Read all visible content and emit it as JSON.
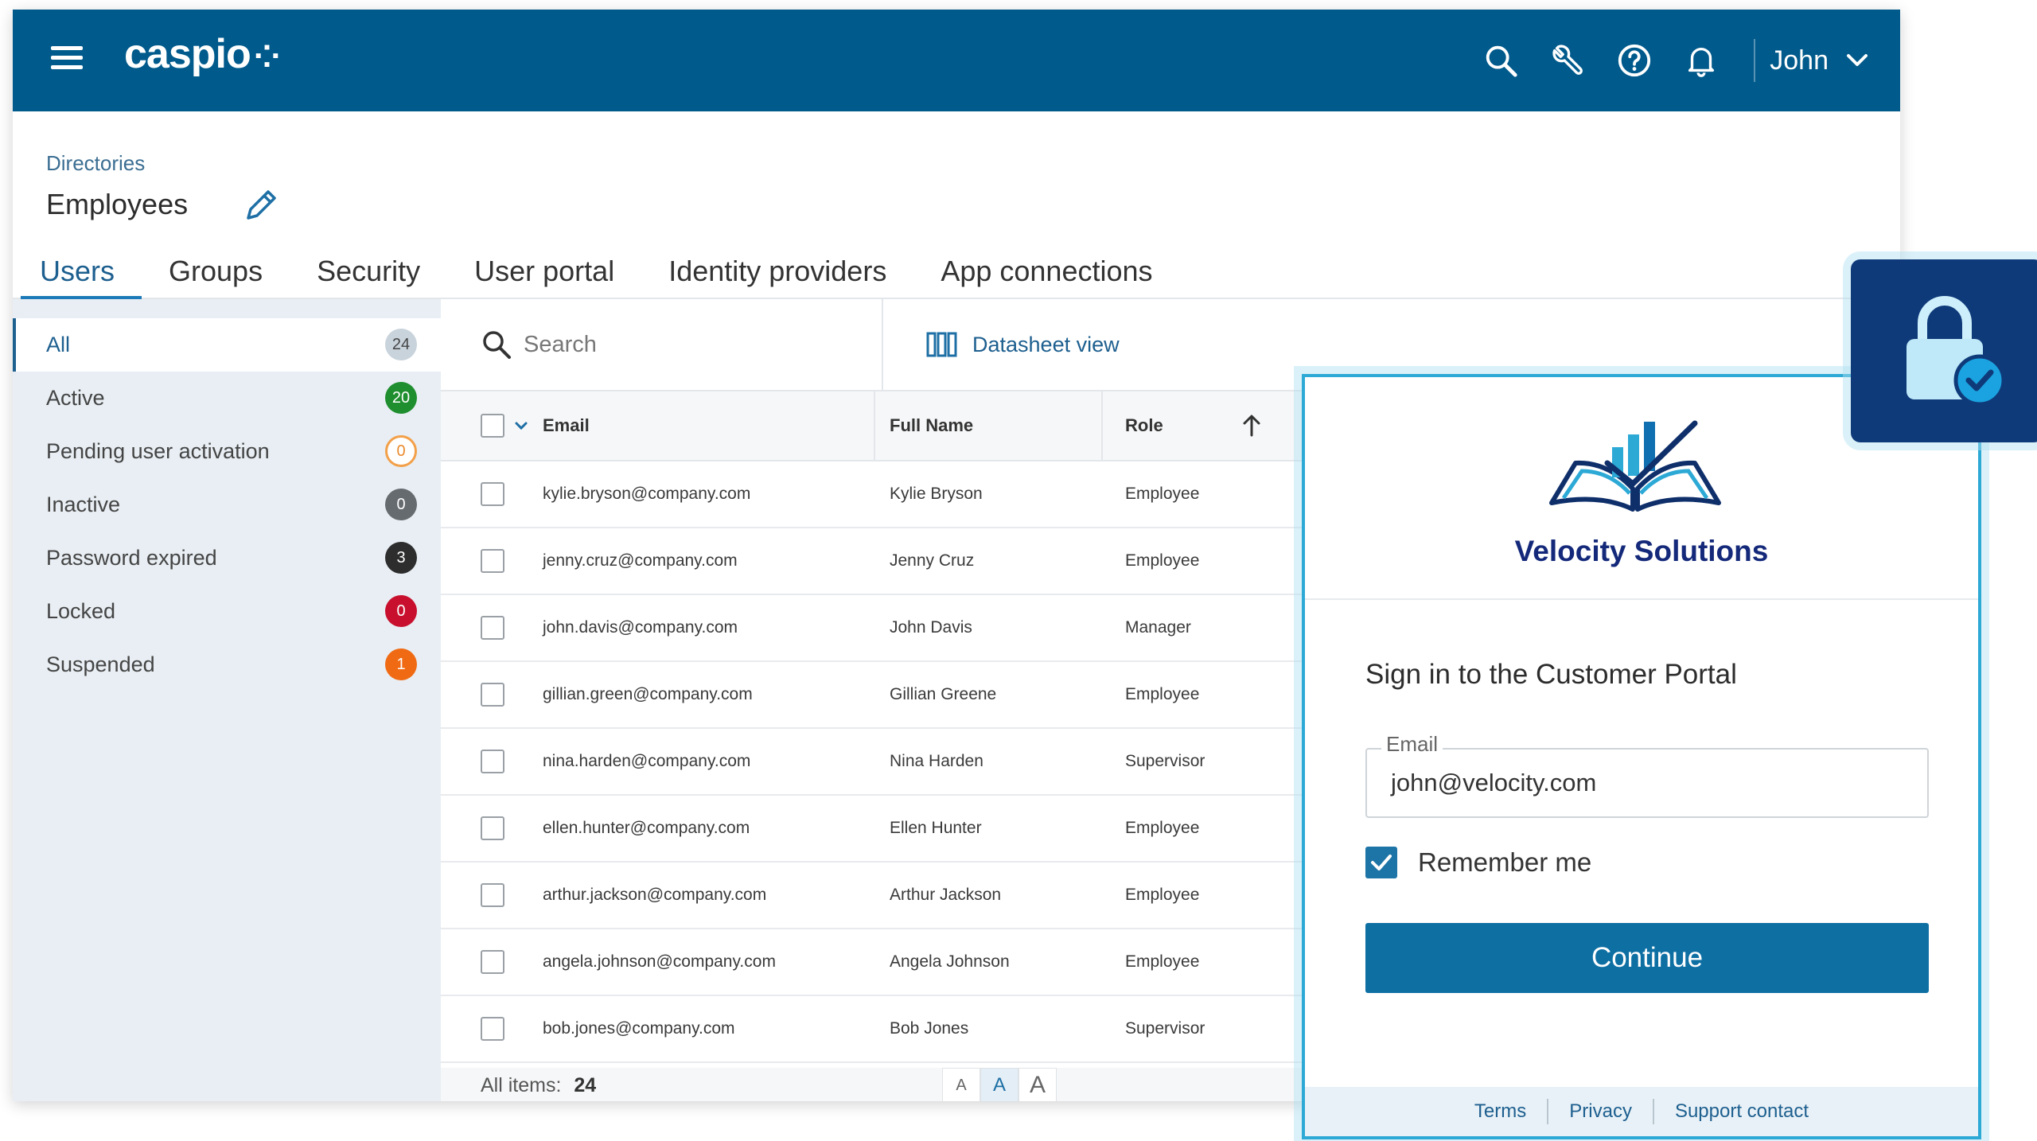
{
  "topbar": {
    "logo_text": "caspio",
    "logo_mark": "⁘",
    "icons": [
      "search-icon",
      "wrench-icon",
      "help-icon",
      "bell-icon"
    ],
    "user_name": "John",
    "bg_color": "#005a8b"
  },
  "header": {
    "breadcrumb": "Directories",
    "title": "Employees",
    "tabs": [
      {
        "label": "Users",
        "active": true
      },
      {
        "label": "Groups"
      },
      {
        "label": "Security"
      },
      {
        "label": "User portal"
      },
      {
        "label": "Identity providers"
      },
      {
        "label": "App connections"
      }
    ]
  },
  "sidebar": {
    "items": [
      {
        "label": "All",
        "count": "24",
        "badge_color": "#c9d3dc"
      },
      {
        "label": "Active",
        "count": "20",
        "badge_color": "#1e8e2e"
      },
      {
        "label": "Pending user activation",
        "count": "0",
        "badge_color": "#f3a04a"
      },
      {
        "label": "Inactive",
        "count": "0",
        "badge_color": "#666b70"
      },
      {
        "label": "Password expired",
        "count": "3",
        "badge_color": "#2d2d2d"
      },
      {
        "label": "Locked",
        "count": "0",
        "badge_color": "#c8102e"
      },
      {
        "label": "Suspended",
        "count": "1",
        "badge_color": "#f06a14"
      }
    ]
  },
  "toolbar": {
    "search_placeholder": "Search",
    "datasheet_label": "Datasheet view"
  },
  "table": {
    "columns": [
      "Email",
      "Full Name",
      "Role"
    ],
    "rows": [
      [
        "kylie.bryson@company.com",
        "Kylie Bryson",
        "Employee"
      ],
      [
        "jenny.cruz@company.com",
        "Jenny Cruz",
        "Employee"
      ],
      [
        "john.davis@company.com",
        "John Davis",
        "Manager"
      ],
      [
        "gillian.green@company.com",
        "Gillian Greene",
        "Employee"
      ],
      [
        "nina.harden@company.com",
        "Nina Harden",
        "Supervisor"
      ],
      [
        "ellen.hunter@company.com",
        "Ellen Hunter",
        "Employee"
      ],
      [
        "arthur.jackson@company.com",
        "Arthur Jackson",
        "Employee"
      ],
      [
        "angela.johnson@company.com",
        "Angela Johnson",
        "Employee"
      ],
      [
        "bob.jones@company.com",
        "Bob Jones",
        "Supervisor"
      ]
    ],
    "footer_label": "All items:",
    "footer_count": "24",
    "font_size_options": [
      "A",
      "A",
      "A"
    ]
  },
  "login": {
    "brand_name": "Velocity Solutions",
    "title": "Sign in to the Customer Portal",
    "email_label": "Email",
    "email_value": "john@velocity.com",
    "remember_label": "Remember me",
    "remember_checked": true,
    "continue_label": "Continue",
    "footer_links": [
      "Terms",
      "Privacy",
      "Support contact"
    ],
    "accent_color": "#2da9d6",
    "brand_color": "#14297a"
  },
  "lock_tile": {
    "icon": "lock-check-icon",
    "bg_color": "#0f3a7a"
  }
}
